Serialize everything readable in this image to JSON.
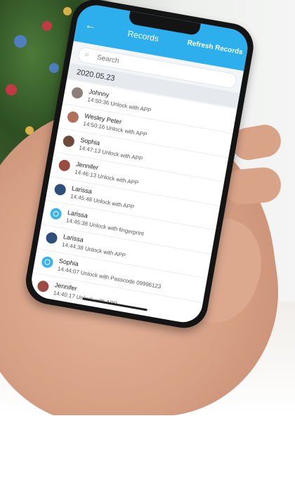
{
  "header": {
    "back_icon": "back-arrow-icon",
    "title": "Records",
    "refresh_label": "Refresh Records"
  },
  "search": {
    "placeholder": "Search",
    "icon": "search-icon"
  },
  "date_group": "2020.05.23",
  "records": [
    {
      "name": "Johnny",
      "detail": "14:50:36 Unlock with APP",
      "avatar": "photo",
      "color": "#8a7f79"
    },
    {
      "name": "Wesley Peter",
      "detail": "14:50:16 Unlock with APP",
      "avatar": "photo",
      "color": "#b0705a"
    },
    {
      "name": "Sophia",
      "detail": "14:47:13 Unlock with APP",
      "avatar": "photo",
      "color": "#6d4a3a"
    },
    {
      "name": "Jennifer",
      "detail": "14:46:13 Unlock with APP",
      "avatar": "photo",
      "color": "#9a4c42"
    },
    {
      "name": "Larissa",
      "detail": "14:45:48 Unlock with APP",
      "avatar": "photo",
      "color": "#2f4e7a"
    },
    {
      "name": "Larissa",
      "detail": "14:45:38 Unlock with fingerprint",
      "avatar": "fingerprint",
      "color": "#36b3f0"
    },
    {
      "name": "Larissa",
      "detail": "14:44:38 Unlock with APP",
      "avatar": "photo",
      "color": "#2f4e7a"
    },
    {
      "name": "Sophia",
      "detail": "14:44:07 Unlock with Passcode 09996123",
      "avatar": "passcode",
      "color": "#36b3f0"
    },
    {
      "name": "Jennifer",
      "detail": "14:40:17 Unlock with APP",
      "avatar": "photo",
      "color": "#9a4c42"
    }
  ],
  "colors": {
    "accent": "#2daeed"
  }
}
